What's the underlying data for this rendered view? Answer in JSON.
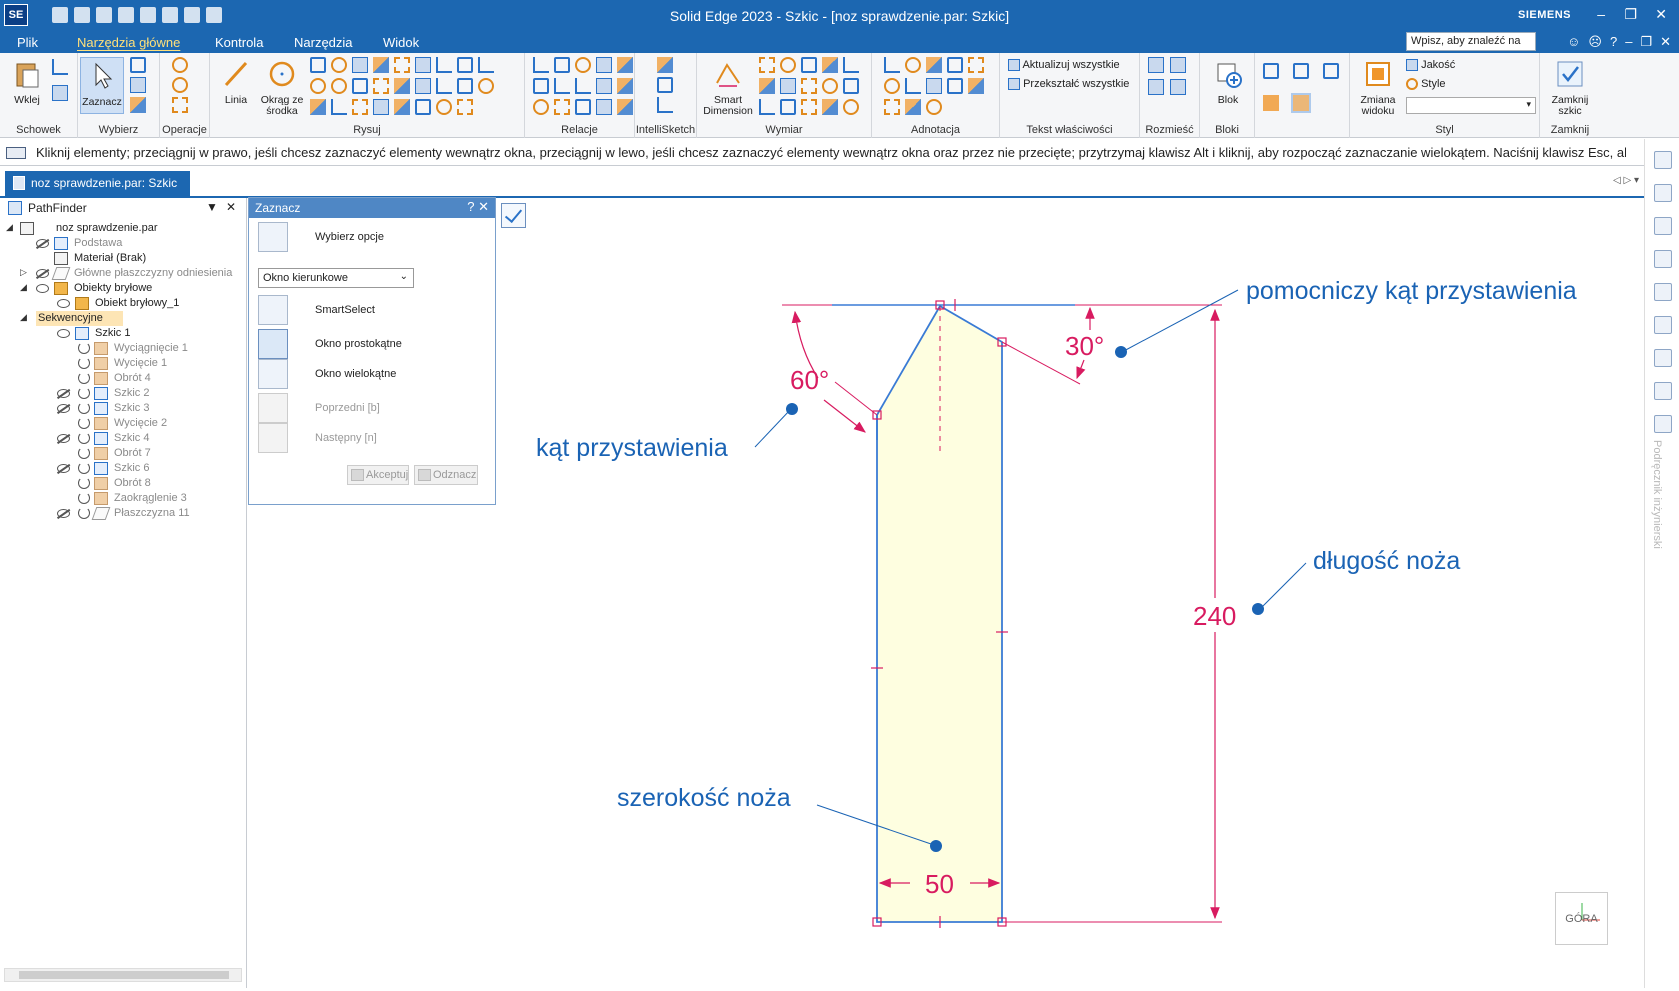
{
  "titlebar": {
    "logo": "SE",
    "title": "Solid Edge 2023 - Szkic - [noz sprawdzenie.par: Szkic]",
    "brand": "SIEMENS"
  },
  "menu": {
    "tabs": [
      "Plik",
      "Narzędzia główne",
      "Kontrola",
      "Narzędzia",
      "Widok"
    ],
    "search_placeholder": "Wpisz, aby znaleźć na"
  },
  "ribbon": {
    "groups": {
      "schowek": "Schowek",
      "wybierz": "Wybierz",
      "operacje": "Operacje",
      "rysuj": "Rysuj",
      "relacje": "Relacje",
      "intellisketch": "IntelliSketch",
      "wymiar": "Wymiar",
      "adnotacja": "Adnotacja",
      "tekst": "Tekst właściwości",
      "rozmiesc": "Rozmieść",
      "bloki": "Bloki",
      "styl": "Styl",
      "zamknij": "Zamknij"
    },
    "buttons": {
      "wklej": "Wklej",
      "zaznacz": "Zaznacz",
      "linia": "Linia",
      "okrag_line1": "Okrąg ze",
      "okrag_line2": "środka",
      "smart_line1": "Smart",
      "smart_line2": "Dimension",
      "aktualizuj": "Aktualizuj wszystkie",
      "przeksztalc": "Przekształć wszystkie",
      "blok": "Blok",
      "zmiana_line1": "Zmiana",
      "zmiana_line2": "widoku",
      "jakosc": "Jakość",
      "style": "Style",
      "zamknij_line1": "Zamknij",
      "zamknij_line2": "szkic"
    }
  },
  "prompt": {
    "text": "Kliknij elementy; przeciągnij w prawo, jeśli chcesz zaznaczyć elementy wewnątrz okna, przeciągnij w lewo, jeśli chcesz zaznaczyć elementy wewnątrz okna oraz przez nie przecięte; przytrzymaj klawisz Alt i kliknij, aby rozpocząć zaznaczanie wielokątem. Naciśnij klawisz Esc, aby"
  },
  "document_tab": {
    "label": "noz sprawdzenie.par: Szkic"
  },
  "pathfinder": {
    "title": "PathFinder",
    "items": [
      {
        "label": "noz sprawdzenie.par"
      },
      {
        "label": "Podstawa"
      },
      {
        "label": "Materiał (Brak)"
      },
      {
        "label": "Główne płaszczyzny odniesienia"
      },
      {
        "label": "Obiekty bryłowe"
      },
      {
        "label": "Obiekt bryłowy_1"
      },
      {
        "label": "Sekwencyjne"
      },
      {
        "label": "Szkic 1"
      },
      {
        "label": "Wyciągnięcie 1"
      },
      {
        "label": "Wycięcie 1"
      },
      {
        "label": "Obrót 4"
      },
      {
        "label": "Szkic 2"
      },
      {
        "label": "Szkic 3"
      },
      {
        "label": "Wycięcie 2"
      },
      {
        "label": "Szkic 4"
      },
      {
        "label": "Obrót 7"
      },
      {
        "label": "Szkic 6"
      },
      {
        "label": "Obrót 8"
      },
      {
        "label": "Zaokrąglenie 3"
      },
      {
        "label": "Płaszczyzna 11"
      }
    ]
  },
  "dialog": {
    "title": "Zaznacz",
    "wybierz_opcje": "Wybierz opcje",
    "select_value": "Okno kierunkowe",
    "smartselect": "SmartSelect",
    "okno_prostokatne": "Okno prostokątne",
    "okno_wielokatne": "Okno wielokątne",
    "poprzedni": "Poprzedni [b]",
    "nastepny": "Następny [n]",
    "akceptuj": "Akceptuj",
    "odznacz": "Odznacz"
  },
  "sketch": {
    "dimensions": {
      "angle_left": "60°",
      "angle_right": "30°",
      "length": "240",
      "width": "50"
    },
    "annotations": {
      "helper_angle": "pomocniczy kąt przystawienia",
      "set_angle": "kąt przystawienia",
      "knife_length": "długość noża",
      "knife_width": "szerokość noża"
    },
    "colors": {
      "dimension": "#d81b60",
      "annotation": "#1a63b4",
      "profile": "#3a7bd5",
      "fill": "#fefee0"
    }
  },
  "viewcube": {
    "label": "GÓRA"
  },
  "right_panel": {
    "vertical_label": "Podręcznik inżynierski"
  }
}
